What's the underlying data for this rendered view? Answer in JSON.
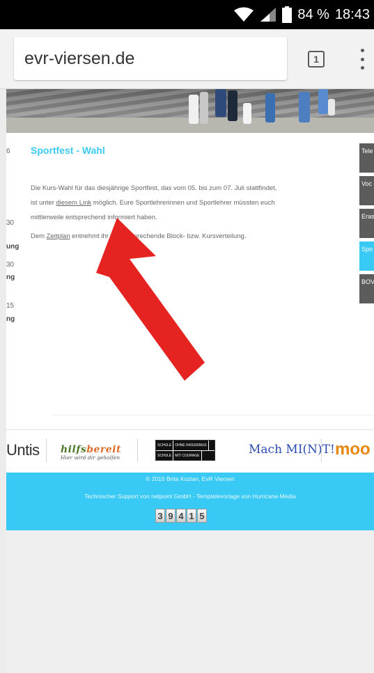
{
  "status": {
    "battery_pct": "84 %",
    "time": "18:43"
  },
  "browser": {
    "url": "evr-viersen.de",
    "tab_count": "1"
  },
  "left_sidebar": [
    {
      "text": "6",
      "bold": false
    },
    {
      "text": "30",
      "bold": false
    },
    {
      "text": "ung",
      "bold": true
    },
    {
      "text": "30",
      "bold": false
    },
    {
      "text": "ng",
      "bold": true
    },
    {
      "text": "15",
      "bold": false
    },
    {
      "text": "ng",
      "bold": true
    }
  ],
  "article": {
    "title": "Sportfest - Wahl",
    "p1_line1": "Die Kurs-Wahl für das diesjährige Sportfest, das vom 05. bis zum 07. Juli stattfindet,",
    "p1_line2_pre": "ist unter ",
    "p1_link": "diesem Link",
    "p1_line2_post": " möglich. Eure Sportlehrerinnen und Sportlehrer müssten euch",
    "p1_line3": "mittlerweile entsprechend informiert haben.",
    "p2_pre": "Dem ",
    "p2_link": "Zeitplan",
    "p2_post": " entnehmt ihr die entsprechende Block- bzw. Kursverteilung."
  },
  "right_tabs": [
    {
      "label": "Tele",
      "active": false
    },
    {
      "label": "Voc",
      "active": false
    },
    {
      "label": "Eras",
      "active": false
    },
    {
      "label": "Spo",
      "active": true
    },
    {
      "label": "BOV",
      "active": false
    }
  ],
  "logos": {
    "untis": "Untis",
    "hilfs_a": "hilfs",
    "hilfs_b": "bereit",
    "hilfs_tag": "Hier wird dir geholfen",
    "srsc_1a": "SCHULE",
    "srsc_1b": "OHNE RASSISMUS",
    "srsc_2a": "SCHULE",
    "srsc_2b": "MIT COURAGE",
    "machmit": "Mach MI(N)T!",
    "moodle": "moo"
  },
  "footer": {
    "copyright": "© 2015 Brita Kozian, EvR Viersen",
    "support": "Technischer Support von netpoint GmbH - Templatevorlage von Hurricane Media",
    "counter": [
      "3",
      "9",
      "4",
      "1",
      "5"
    ]
  },
  "colors": {
    "accent": "#38c9f4",
    "arrow": "#e52421"
  }
}
